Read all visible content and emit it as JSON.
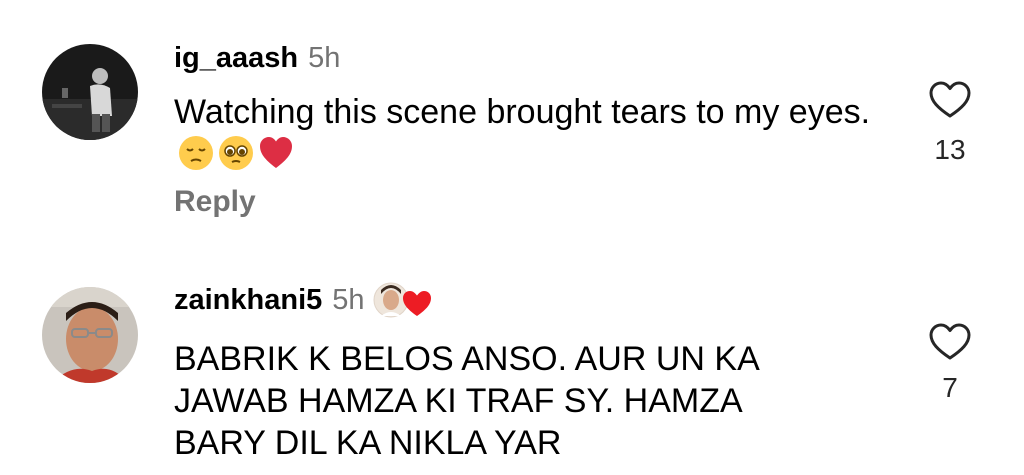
{
  "comments": [
    {
      "username": "ig_aaash",
      "time": "5h",
      "text": "Watching this scene brought tears to my eyes.",
      "emojis": [
        "pensive-face",
        "pleading-face",
        "red-heart"
      ],
      "reply_label": "Reply",
      "like_count": "13"
    },
    {
      "username": "zainkhani5",
      "time": "5h",
      "creator_liked": true,
      "text_lines": [
        "BABRIK K BELOS ANSO. AUR UN KA",
        "JAWAB HAMZA KI TRAF SY. HAMZA",
        "BARY DIL KA NIKLA YAR"
      ],
      "like_count": "7"
    }
  ],
  "colors": {
    "text": "#000000",
    "secondary": "#737373",
    "heart_red": "#ed1c24"
  }
}
